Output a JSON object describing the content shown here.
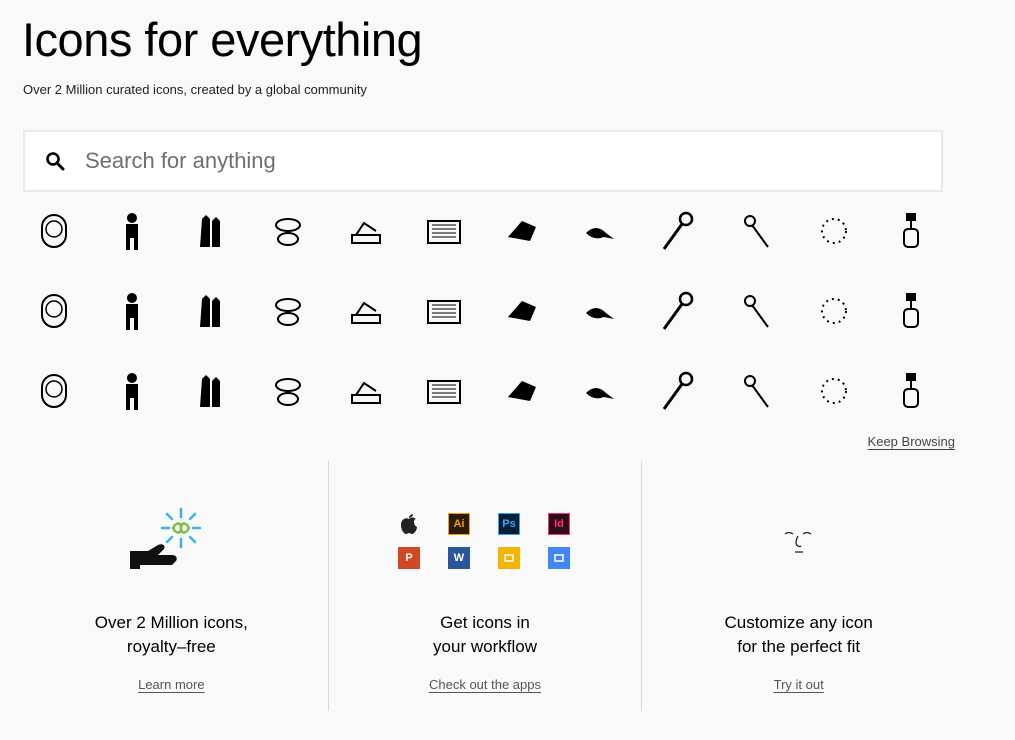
{
  "hero": {
    "title": "Icons for everything",
    "subtitle": "Over 2 Million curated icons, created by a global community"
  },
  "search": {
    "placeholder": "Search for anything",
    "icon": "search-icon"
  },
  "icons": [
    "hooded-face-icon",
    "person-binoculars-icon",
    "robed-figures-icon",
    "oysters-icon",
    "butter-dish-icon",
    "amplifier-icon",
    "origami-bird-icon",
    "seal-icon",
    "eye-screw-icon",
    "herb-bundle-icon",
    "dotted-circle-icon",
    "cable-car-icon",
    "lab-flasks-icon",
    "typewriter-icon",
    "daruma-doll-icon",
    "money-transfer-icon",
    "abstract-bird-icon",
    "containers-icon",
    "paper-bag-icon",
    "handshake-icon",
    "coin-stacks-icon",
    "trophy-icon",
    "nose-icon",
    "bouncing-ball-icon",
    "dancer-icon",
    "dropper-icon",
    "scissors-icon",
    "c-clamp-icon",
    "ring-icon",
    "oil-rig-icon",
    "couple-icon",
    "brain-network-icon",
    "teapot-icon",
    "cassette-icon",
    "patterned-egg-icon",
    "stilt-house-icon"
  ],
  "keep_browsing": "Keep Browsing",
  "features": [
    {
      "title": "Over 2 Million icons,\nroyalty–free",
      "link": "Learn more",
      "art": "hand-infinity-icon"
    },
    {
      "title": "Get icons in\nyour workflow",
      "link": "Check out the apps",
      "apps": [
        {
          "name": "apple-icon",
          "label": "",
          "bg": "transparent",
          "fg": "#222"
        },
        {
          "name": "illustrator-icon",
          "label": "Ai",
          "bg": "#2a1a0a",
          "fg": "#ff9a00"
        },
        {
          "name": "photoshop-icon",
          "label": "Ps",
          "bg": "#061e33",
          "fg": "#31a8ff"
        },
        {
          "name": "indesign-icon",
          "label": "Id",
          "bg": "#2e0a1a",
          "fg": "#ff3366"
        },
        {
          "name": "powerpoint-icon",
          "label": "P",
          "bg": "#d24726",
          "fg": "#ffffff"
        },
        {
          "name": "word-icon",
          "label": "W",
          "bg": "#2b579a",
          "fg": "#ffffff"
        },
        {
          "name": "google-slides-icon",
          "label": "",
          "bg": "#f4b400",
          "fg": "#ffffff"
        },
        {
          "name": "google-docs-icon",
          "label": "",
          "bg": "#4285f4",
          "fg": "#ffffff"
        }
      ]
    },
    {
      "title": "Customize any icon\nfor the perfect fit",
      "link": "Try it out",
      "art": "face-sketch-icon"
    }
  ]
}
